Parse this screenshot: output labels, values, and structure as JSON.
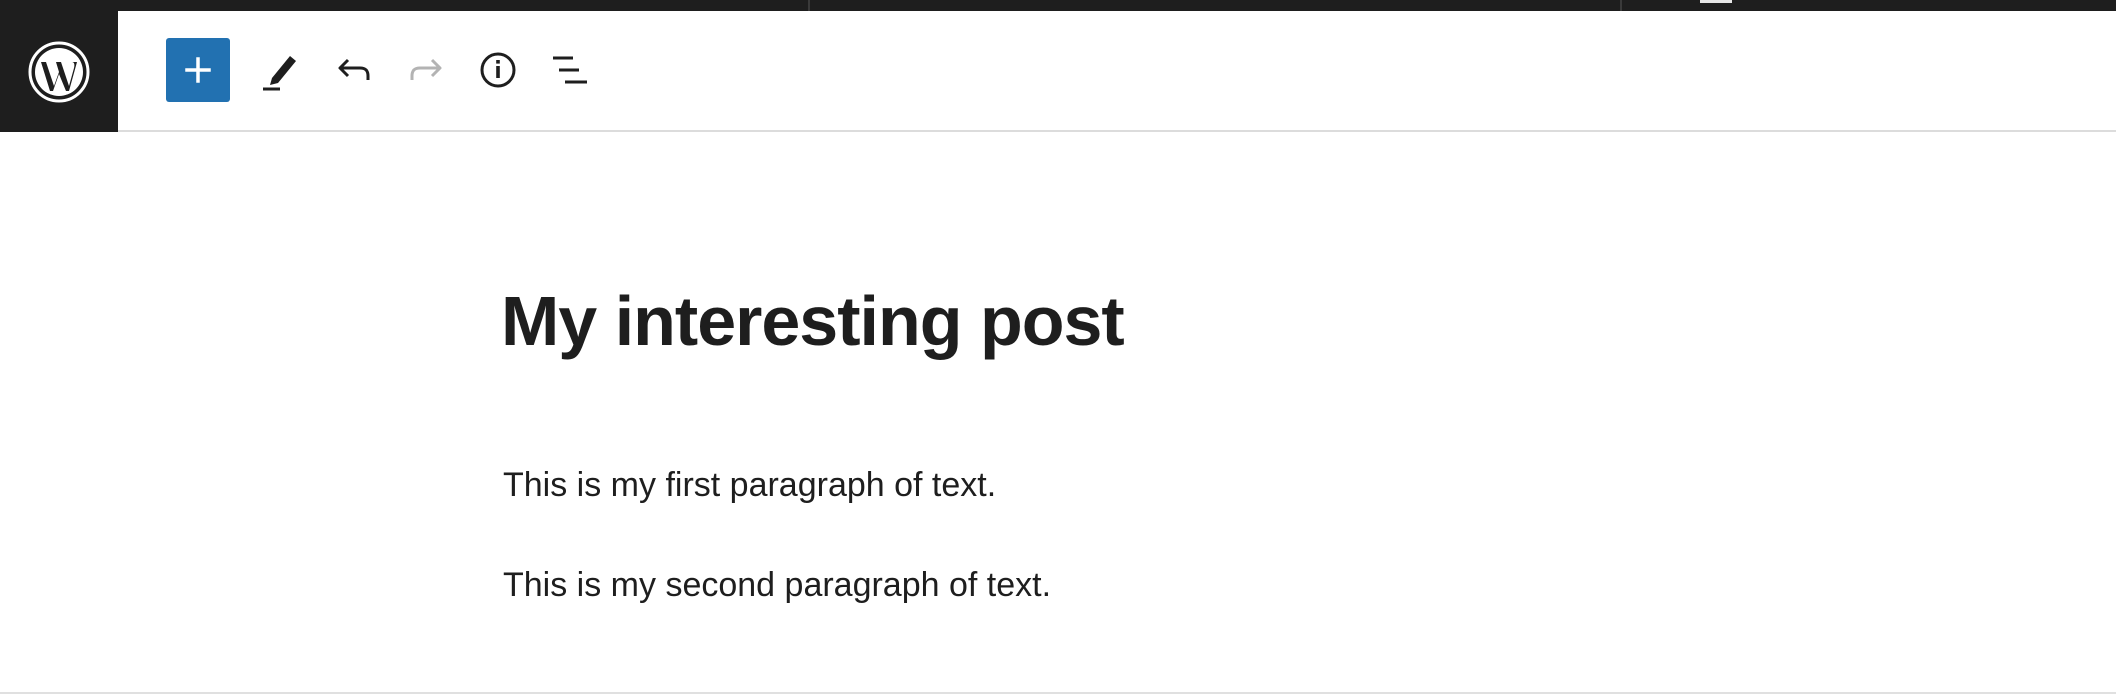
{
  "toolbar": {
    "logo_icon": "wordpress-logo-icon",
    "add_block_icon": "plus-icon",
    "tools_icon": "pencil-icon",
    "undo_icon": "undo-icon",
    "redo_icon": "redo-icon",
    "details_icon": "info-icon",
    "outline_icon": "list-view-icon",
    "accent_color": "#2271b1"
  },
  "post": {
    "title": "My interesting post",
    "paragraphs": [
      "This is my first paragraph of text.",
      "This is my second paragraph of text."
    ]
  }
}
